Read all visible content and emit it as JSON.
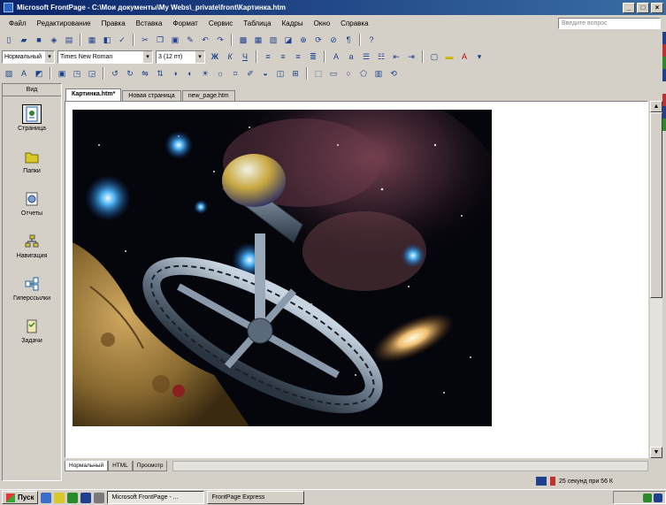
{
  "window": {
    "title": "Microsoft FrontPage - C:\\Мои документы\\My Webs\\_private\\front\\Картинка.htm"
  },
  "menu": {
    "items": [
      "Файл",
      "Редактирование",
      "Правка",
      "Вставка",
      "Формат",
      "Сервис",
      "Таблица",
      "Кадры",
      "Окно",
      "Справка"
    ],
    "help_placeholder": "Введите вопрос"
  },
  "toolbar": {
    "style_combo": "Нормальный",
    "font_combo": "Times New Roman",
    "size_combo": "3 (12 пт)"
  },
  "views": {
    "header": "Вид",
    "items": [
      {
        "label": "Страница",
        "icon": "page-view-icon"
      },
      {
        "label": "Папки",
        "icon": "folders-icon"
      },
      {
        "label": "Отчеты",
        "icon": "reports-icon"
      },
      {
        "label": "Навигация",
        "icon": "navigation-icon"
      },
      {
        "label": "Гиперссылки",
        "icon": "hyperlinks-icon"
      },
      {
        "label": "Задачи",
        "icon": "tasks-icon"
      }
    ]
  },
  "doc_tabs": [
    "Картинка.htm*",
    "Новая страница",
    "new_page.htm"
  ],
  "view_tabs": [
    "Нормальный",
    "HTML",
    "Просмотр"
  ],
  "status": {
    "text": "25 секунд при 56 К"
  },
  "taskbar": {
    "start_label": "Пуск",
    "tasks": [
      "Microsoft FrontPage - ...",
      "FrontPage Express"
    ]
  },
  "colors": {
    "titlebar_start": "#0a246a",
    "titlebar_end": "#3a6ea5",
    "face": "#d4d0c8"
  }
}
